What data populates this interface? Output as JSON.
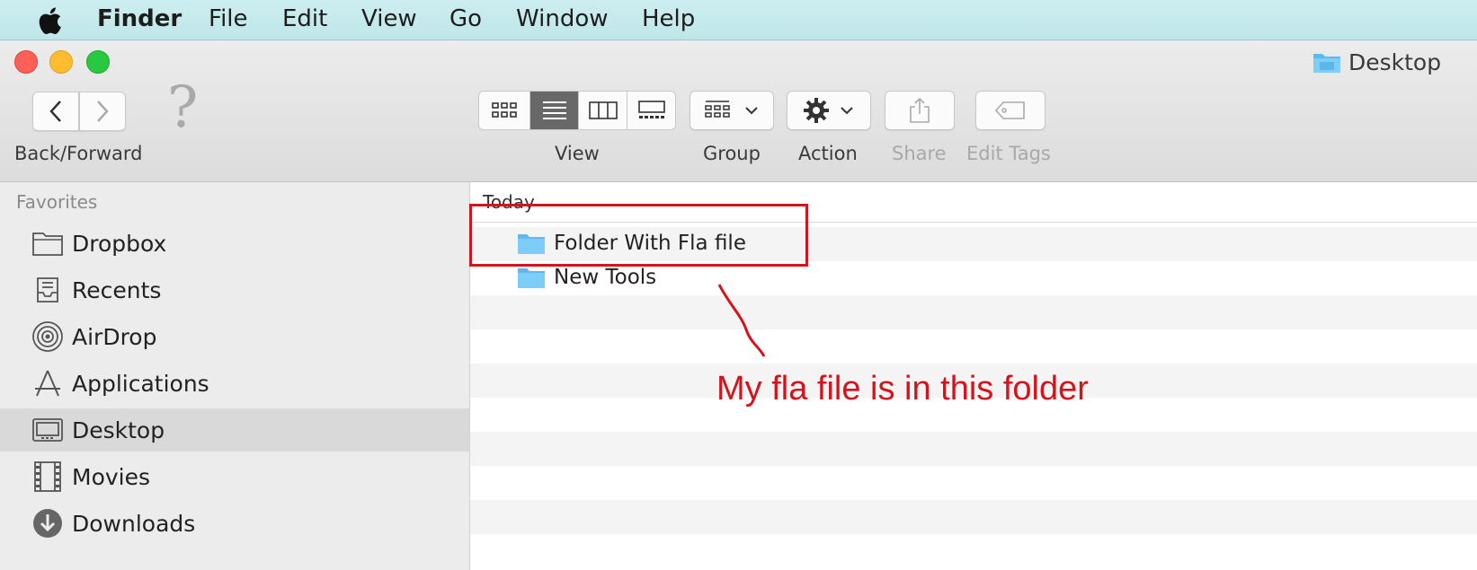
{
  "menubar": {
    "app": "Finder",
    "items": [
      "File",
      "Edit",
      "View",
      "Go",
      "Window",
      "Help"
    ]
  },
  "window": {
    "title": "Desktop",
    "title_icon": "folder-icon"
  },
  "toolbar": {
    "nav_label": "Back/Forward",
    "back_icon": "chevron-left-icon",
    "forward_icon": "chevron-right-icon",
    "help_glyph": "?",
    "view_label": "View",
    "view_modes": [
      "icon-view",
      "list-view",
      "column-view",
      "gallery-view"
    ],
    "active_view": "list-view",
    "group_label": "Group",
    "action_label": "Action",
    "share_label": "Share",
    "edit_tags_label": "Edit Tags"
  },
  "sidebar": {
    "heading": "Favorites",
    "items": [
      {
        "label": "Dropbox",
        "icon": "folder-icon"
      },
      {
        "label": "Recents",
        "icon": "recents-icon"
      },
      {
        "label": "AirDrop",
        "icon": "airdrop-icon"
      },
      {
        "label": "Applications",
        "icon": "applications-icon"
      },
      {
        "label": "Desktop",
        "icon": "desktop-icon",
        "selected": true
      },
      {
        "label": "Movies",
        "icon": "movies-icon"
      },
      {
        "label": "Downloads",
        "icon": "downloads-icon"
      }
    ]
  },
  "content": {
    "section": "Today",
    "files": [
      {
        "name": "Folder With Fla file",
        "icon": "folder-icon"
      },
      {
        "name": "New Tools",
        "icon": "folder-icon"
      }
    ]
  },
  "annotation": {
    "text": "My fla file is in this folder",
    "color": "#d6121a"
  },
  "colors": {
    "menubar": "#c6eaed",
    "selected_view": "#686868",
    "sidebar": "#ececec",
    "folder": "#6cc4f5"
  }
}
